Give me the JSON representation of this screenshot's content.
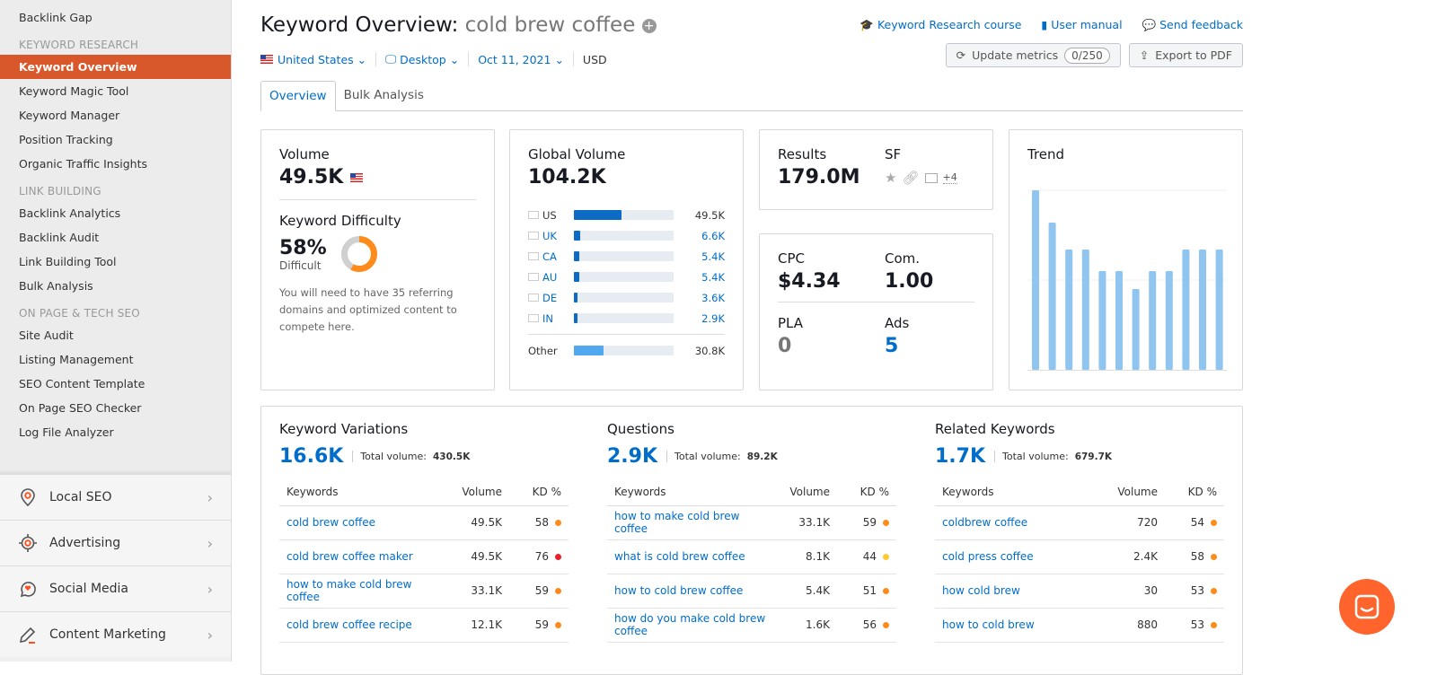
{
  "sidebar": {
    "top_item": "Backlink Gap",
    "groups": [
      {
        "heading": "KEYWORD RESEARCH",
        "items": [
          "Keyword Overview",
          "Keyword Magic Tool",
          "Keyword Manager",
          "Position Tracking",
          "Organic Traffic Insights"
        ]
      },
      {
        "heading": "LINK BUILDING",
        "items": [
          "Backlink Analytics",
          "Backlink Audit",
          "Link Building Tool",
          "Bulk Analysis"
        ]
      },
      {
        "heading": "ON PAGE & TECH SEO",
        "items": [
          "Site Audit",
          "Listing Management",
          "SEO Content Template",
          "On Page SEO Checker",
          "Log File Analyzer"
        ]
      }
    ],
    "active": "Keyword Overview",
    "sections": [
      {
        "label": "Local SEO",
        "icon": "map-pin-icon"
      },
      {
        "label": "Advertising",
        "icon": "target-icon"
      },
      {
        "label": "Social Media",
        "icon": "chat-heart-icon"
      },
      {
        "label": "Content Marketing",
        "icon": "pencil-icon"
      }
    ]
  },
  "header": {
    "title": "Keyword Overview:",
    "keyword": "cold brew coffee",
    "filters": {
      "country": "United States",
      "device": "Desktop",
      "date": "Oct 11, 2021",
      "currency": "USD"
    },
    "links": [
      "Keyword Research course",
      "User manual",
      "Send feedback"
    ],
    "update_label": "Update metrics",
    "update_count": "0/250",
    "export_label": "Export to PDF"
  },
  "tabs": [
    "Overview",
    "Bulk Analysis"
  ],
  "volume": {
    "title": "Volume",
    "value": "49.5K",
    "kd_title": "Keyword Difficulty",
    "kd_value": "58%",
    "kd_percent": 58,
    "kd_label": "Difficult",
    "kd_note": "You will need to have 35 referring domains and optimized content to compete here."
  },
  "global_volume": {
    "title": "Global Volume",
    "value": "104.2K",
    "rows": [
      {
        "code": "US",
        "value": "49.5K",
        "num": 49.5
      },
      {
        "code": "UK",
        "value": "6.6K",
        "num": 6.6
      },
      {
        "code": "CA",
        "value": "5.4K",
        "num": 5.4
      },
      {
        "code": "AU",
        "value": "5.4K",
        "num": 5.4
      },
      {
        "code": "DE",
        "value": "3.6K",
        "num": 3.6
      },
      {
        "code": "IN",
        "value": "2.9K",
        "num": 2.9
      }
    ],
    "other": {
      "code": "Other",
      "value": "30.8K",
      "num": 30.8
    },
    "total_num": 104.2
  },
  "results": {
    "title": "Results",
    "value": "179.0M",
    "sf_title": "SF",
    "sf_more": "+4"
  },
  "cpc": {
    "cpc_title": "CPC",
    "cpc_value": "$4.34",
    "com_title": "Com.",
    "com_value": "1.00",
    "pla_title": "PLA",
    "pla_value": "0",
    "ads_title": "Ads",
    "ads_value": "5"
  },
  "trend": {
    "title": "Trend",
    "values": [
      1.0,
      0.82,
      0.67,
      0.67,
      0.55,
      0.55,
      0.45,
      0.55,
      0.55,
      0.67,
      0.67,
      0.67
    ],
    "color": "#8fc5ef"
  },
  "kd_colors": {
    "high": "#e8202a",
    "mid": "#ff8c1a",
    "low": "#ffc933"
  },
  "lists": [
    {
      "title": "Keyword Variations",
      "count": "16.6K",
      "total_label": "Total volume:",
      "total": "430.5K",
      "headers": [
        "Keywords",
        "Volume",
        "KD %"
      ],
      "rows": [
        {
          "k": "cold brew coffee",
          "v": "49.5K",
          "kd": "58",
          "c": "mid"
        },
        {
          "k": "cold brew coffee maker",
          "v": "49.5K",
          "kd": "76",
          "c": "high"
        },
        {
          "k": "how to make cold brew coffee",
          "v": "33.1K",
          "kd": "59",
          "c": "mid"
        },
        {
          "k": "cold brew coffee recipe",
          "v": "12.1K",
          "kd": "59",
          "c": "mid"
        }
      ]
    },
    {
      "title": "Questions",
      "count": "2.9K",
      "total_label": "Total volume:",
      "total": "89.2K",
      "headers": [
        "Keywords",
        "Volume",
        "KD %"
      ],
      "rows": [
        {
          "k": "how to make cold brew coffee",
          "v": "33.1K",
          "kd": "59",
          "c": "mid"
        },
        {
          "k": "what is cold brew coffee",
          "v": "8.1K",
          "kd": "44",
          "c": "low"
        },
        {
          "k": "how to cold brew coffee",
          "v": "5.4K",
          "kd": "51",
          "c": "mid"
        },
        {
          "k": "how do you make cold brew coffee",
          "v": "1.6K",
          "kd": "56",
          "c": "mid"
        }
      ]
    },
    {
      "title": "Related Keywords",
      "count": "1.7K",
      "total_label": "Total volume:",
      "total": "679.7K",
      "headers": [
        "Keywords",
        "Volume",
        "KD %"
      ],
      "rows": [
        {
          "k": "coldbrew coffee",
          "v": "720",
          "kd": "54",
          "c": "mid"
        },
        {
          "k": "cold press coffee",
          "v": "2.4K",
          "kd": "58",
          "c": "mid"
        },
        {
          "k": "how cold brew",
          "v": "30",
          "kd": "53",
          "c": "mid"
        },
        {
          "k": "how to cold brew",
          "v": "880",
          "kd": "53",
          "c": "mid"
        }
      ]
    }
  ]
}
